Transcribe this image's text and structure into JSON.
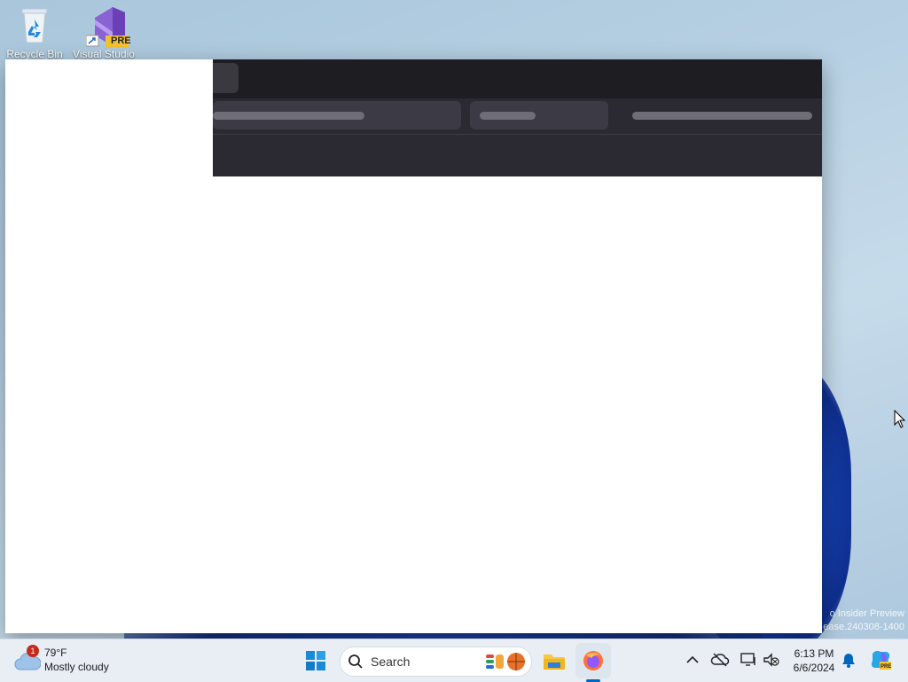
{
  "desktop": {
    "icons": [
      {
        "name": "recycle-bin",
        "label": "Recycle Bin"
      },
      {
        "name": "visual-studio-preview",
        "label": "Visual Studio",
        "badge": "PRE"
      }
    ],
    "watermark": {
      "line1": "o Insider Preview",
      "line2": "ease.240308-1400"
    }
  },
  "browser": {
    "theme_colors": {
      "titlebar": "#1e1d22",
      "toolbar": "#2b2a33",
      "skeleton": "#6f6e78"
    }
  },
  "taskbar": {
    "weather": {
      "temp": "79°F",
      "condition": "Mostly cloudy",
      "alert_count": "1"
    },
    "search": {
      "label": "Search"
    },
    "apps": [
      "start-button",
      "search",
      "widgets",
      "file-explorer",
      "firefox"
    ],
    "clock": {
      "time": "6:13 PM",
      "date": "6/6/2024"
    },
    "tray": [
      "show-hidden-icons",
      "onedrive",
      "network",
      "volume",
      "notifications",
      "copilot"
    ],
    "accent": "#0067c0"
  }
}
